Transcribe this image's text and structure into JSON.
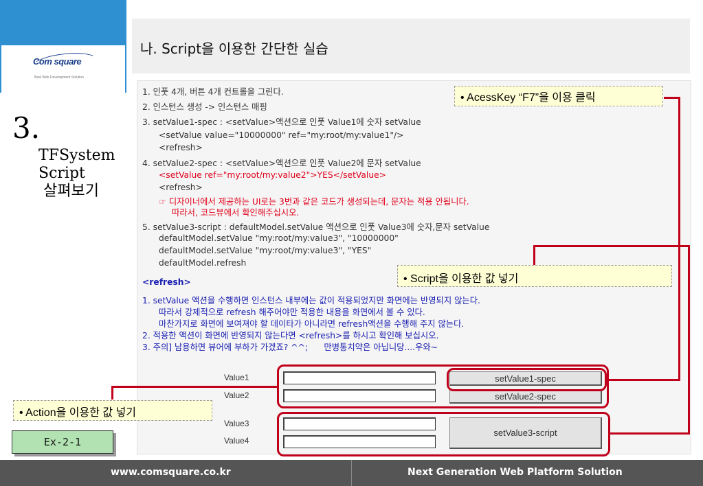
{
  "logo": {
    "brand": "Com square",
    "tagline": "Best Web Development Solution"
  },
  "section": {
    "number": "3.",
    "title_lines": [
      "TFSystem",
      "Script",
      " 살펴보기"
    ]
  },
  "title": "나. Script을 이용한 간단한 실습",
  "content_lines": [
    "1. 인풋 4개, 버튼 4개 컨트롤을 그린다.",
    "2. 인스턴스 생성 -> 인스턴스 매핑",
    "3. setValue1-spec : <setValue>액션으로 인풋 Value1에 숫자 setValue",
    "<setValue value=\"10000000\" ref=\"my:root/my:value1\"/>",
    "<refresh>",
    "4. setValue2-spec : <setValue>액션으로 인풋 Value2에 문자 setValue",
    "<setValue ref=\"my:root/my:value2\">YES</setValue>",
    "<refresh>",
    "☞ 디자이너에서 제공하는 UI로는 3번과 같은 코드가 생성되는데, 문자는 적용 안됩니다.",
    "따라서, 코드뷰에서 확인해주십시오.",
    "5. setValue3-script : defaultModel.setValue 액션으로 인풋 Value3에 숫자,문자 setValue",
    "defaultModel.setValue \"my:root/my:value3\", \"10000000\"",
    "defaultModel.setValue \"my:root/my:value3\", \"YES\"",
    "defaultModel.refresh",
    "<refresh>",
    "1. setValue 액션을 수행하면 인스턴스 내부에는 값이 적용되었지만 화면에는 반영되지 않는다.",
    "따라서 강제적으로 refresh 해주어야만 적용한 내용을 화면에서 볼 수 있다.",
    "마찬가지로 화면에 보여져야 할 데이타가 아니라면 refresh액션을 수행해 주지 않는다.",
    "2. 적용한 액션이 화면에 반영되지 않는다면 <refresh>를 하시고 확인해 보십시오.",
    "3. 주의] 남용하면 뷰어에 부하가 가겠죠? ^^;      만병통치약은 아닙니당....우와~"
  ],
  "callouts": {
    "accesskey": "• AcessKey “F7”을 이용 클릭",
    "script": "• Script을 이용한 값 넣기",
    "action": "• Action을 이용한 값 넣기"
  },
  "form": {
    "labels": [
      "Value1",
      "Value2",
      "Value3",
      "Value4"
    ],
    "buttons": [
      "setValue1-spec",
      "setValue2-spec",
      "setValue3-script"
    ]
  },
  "example_label": "Ex-2-1",
  "footer": {
    "left": "www.comsquare.co.kr",
    "right": "Next Generation Web Platform Solution"
  },
  "colors": {
    "accent_red": "#c0001b",
    "logo_blue": "#2e8fd1",
    "callout_bg": "#ffffd6",
    "footer_bg": "#555555"
  }
}
